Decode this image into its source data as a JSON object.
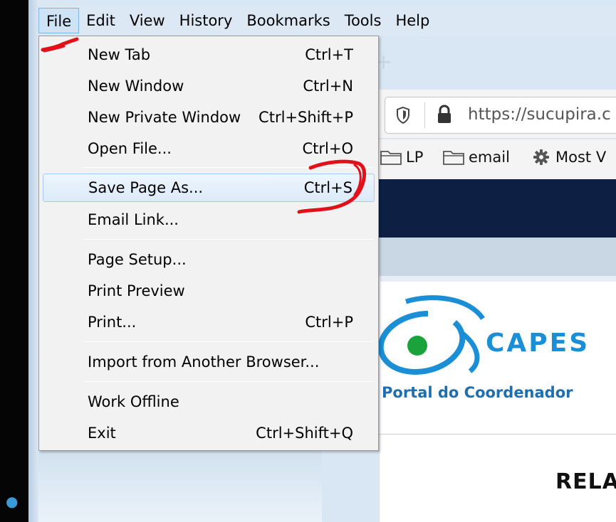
{
  "menubar": {
    "items": [
      "File",
      "Edit",
      "View",
      "History",
      "Bookmarks",
      "Tools",
      "Help"
    ],
    "active": "File"
  },
  "file_menu": {
    "items": [
      {
        "label": "New Tab",
        "shortcut": "Ctrl+T"
      },
      {
        "label": "New Window",
        "shortcut": "Ctrl+N"
      },
      {
        "label": "New Private Window",
        "shortcut": "Ctrl+Shift+P"
      },
      {
        "label": "Open File...",
        "shortcut": "Ctrl+O"
      },
      {
        "label": "Save Page As...",
        "shortcut": "Ctrl+S"
      },
      {
        "label": "Email Link...",
        "shortcut": ""
      },
      {
        "label": "Page Setup...",
        "shortcut": ""
      },
      {
        "label": "Print Preview",
        "shortcut": ""
      },
      {
        "label": "Print...",
        "shortcut": "Ctrl+P"
      },
      {
        "label": "Import from Another Browser...",
        "shortcut": ""
      },
      {
        "label": "Work Offline",
        "shortcut": ""
      },
      {
        "label": "Exit",
        "shortcut": "Ctrl+Shift+Q"
      }
    ],
    "highlighted": "Save Page As..."
  },
  "browser": {
    "url": "https://sucupira.c",
    "bookmarks": [
      "LP",
      "email",
      "Most V"
    ]
  },
  "page": {
    "logo_text": "CAPES",
    "portal_text": "Portal do Coordenador",
    "heading_partial": "RELA"
  },
  "colors": {
    "menubar_bg": "#dce8f4",
    "menu_bg": "#f2f2f2",
    "highlight_border": "#a8cbef",
    "capes_blue": "#1a8fd6",
    "capes_green": "#1aa33a",
    "dark_band": "#0d2043",
    "annotation_red": "#e3101a"
  },
  "icons": [
    "shield-icon",
    "lock-icon",
    "folder-icon",
    "gear-icon",
    "plus-icon"
  ]
}
